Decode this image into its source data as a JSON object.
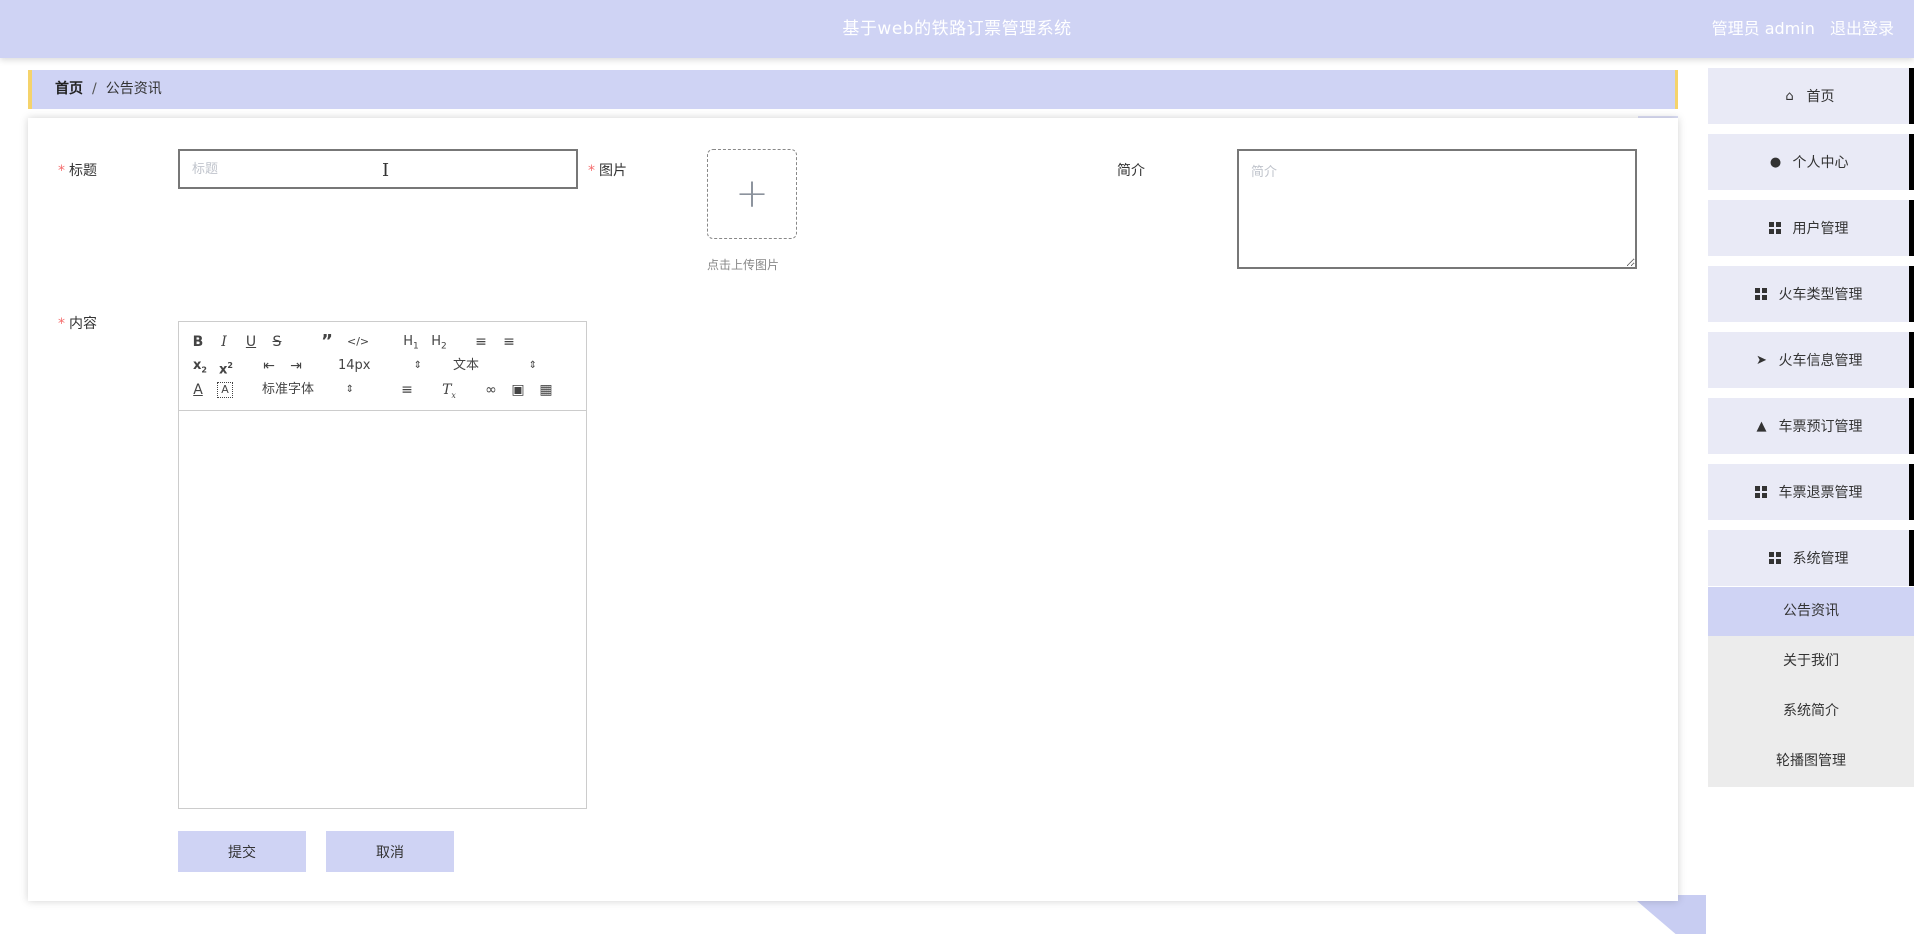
{
  "header": {
    "title": "基于web的铁路订票管理系统",
    "user_label": "管理员 admin",
    "logout_label": "退出登录"
  },
  "breadcrumb": {
    "home": "首页",
    "separator": "/",
    "current": "公告资讯"
  },
  "form": {
    "title_label": "标题",
    "title_placeholder": "标题",
    "title_value": "",
    "image_label": "图片",
    "upload_hint": "点击上传图片",
    "summary_label": "简介",
    "summary_placeholder": "简介",
    "content_label": "内容",
    "submit_label": "提交",
    "cancel_label": "取消"
  },
  "editor": {
    "font_size": "14px",
    "header_select": "文本",
    "font_family": "标准字体"
  },
  "sidebar": {
    "items": [
      {
        "label": "首页",
        "icon": "home-icon"
      },
      {
        "label": "个人中心",
        "icon": "user-icon"
      },
      {
        "label": "用户管理",
        "icon": "grid-icon"
      },
      {
        "label": "火车类型管理",
        "icon": "grid-icon"
      },
      {
        "label": "火车信息管理",
        "icon": "paper-plane-icon"
      },
      {
        "label": "车票预订管理",
        "icon": "stamp-icon"
      },
      {
        "label": "车票退票管理",
        "icon": "grid-icon"
      },
      {
        "label": "系统管理",
        "icon": "grid-icon"
      }
    ],
    "sub_items": [
      {
        "label": "公告资讯",
        "active": true
      },
      {
        "label": "关于我们",
        "active": false
      },
      {
        "label": "系统简介",
        "active": false
      },
      {
        "label": "轮播图管理",
        "active": false
      }
    ]
  },
  "colors": {
    "header_bg": "#cfd3f4",
    "accent_border": "#f5d36b",
    "required": "#f56c6c",
    "menu_bg": "#e9eaf6"
  }
}
